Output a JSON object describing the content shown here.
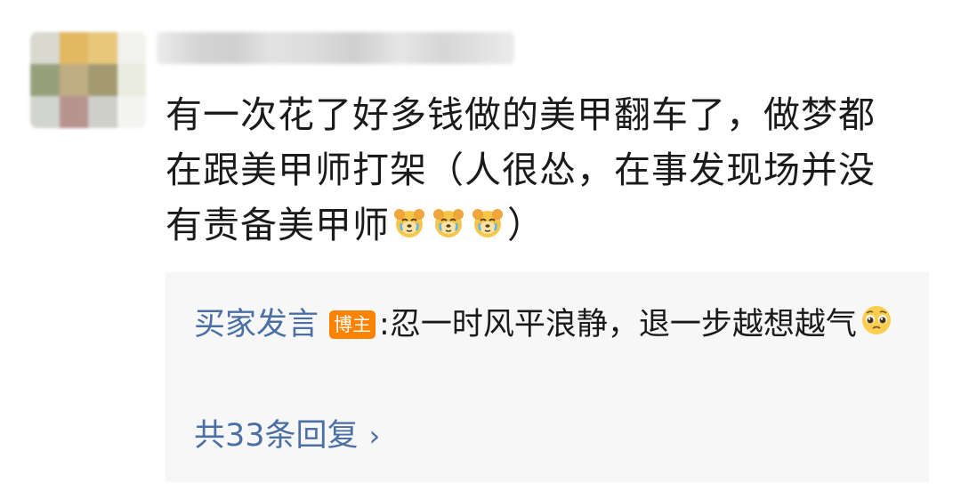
{
  "comment": {
    "text_line_1": "有一次花了好多钱做的美甲翻车了，做梦都",
    "text_line_2": "在跟美甲师打架（人很怂，在事发现场并没",
    "text_line_3": "有责备美甲师",
    "text_close": "）",
    "emojis": [
      "crying-dog-emoji",
      "crying-dog-emoji",
      "crying-dog-emoji"
    ]
  },
  "reply": {
    "username": "买家发言",
    "badge": "博主",
    "separator": ":",
    "text": "忍一时风平浪静，退一步越想越气",
    "emoji": "pleading-face-emoji",
    "reply_count_label": "共33条回复",
    "chevron": "›"
  },
  "colors": {
    "link_blue": "#4a6fa5",
    "badge_orange": "#ff8200",
    "reply_bg": "#f7f7f7",
    "text": "#1a1a1a"
  }
}
